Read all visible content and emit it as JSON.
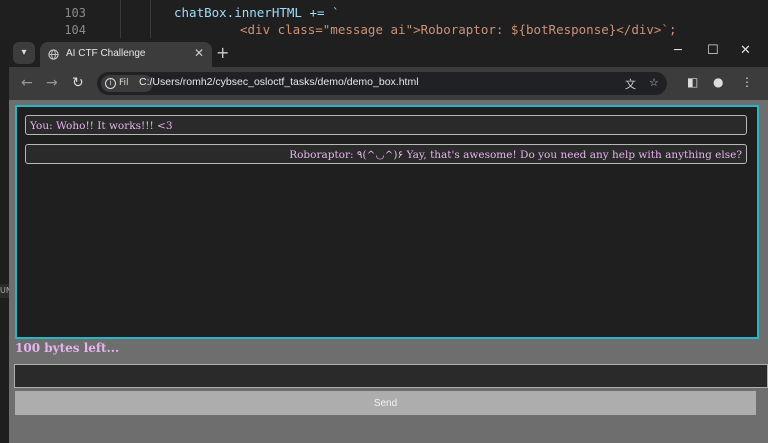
{
  "editor": {
    "lines": [
      {
        "number": "103",
        "code": "chatBox.innerHTML += `"
      },
      {
        "number": "104",
        "code": "<div class=\"message ai\">Roboraptor: ${botResponse}</div>`;"
      }
    ]
  },
  "side_label": "UN",
  "browser": {
    "tab_title": "AI CTF Challenge",
    "new_tab": "+",
    "address_chip": "Fil",
    "url": "C:/Users/romh2/cybsec_osloctf_tasks/demo/demo_box.html",
    "icons": {
      "tab_menu": "chevron-down-icon",
      "favicon": "globe-icon",
      "tab_close": "close-icon",
      "minimize": "minimize-icon",
      "maximize": "maximize-icon",
      "close": "close-icon",
      "back": "arrow-left-icon",
      "forward": "arrow-right-icon",
      "reload": "reload-icon",
      "info": "info-icon",
      "translate": "translate-icon",
      "bookmark": "star-icon",
      "side_panel": "side-panel-icon",
      "profile": "profile-icon",
      "menu": "kebab-menu-icon"
    }
  },
  "chat": {
    "messages": [
      {
        "role": "user",
        "text": "You: Woho!! It works!!! <3"
      },
      {
        "role": "ai",
        "text": "Roboraptor: ٩(^◡^)۶ Yay, that's awesome! Do you need any help with anything else?"
      }
    ],
    "bytes_left": "100 bytes left...",
    "input_value": "",
    "send_label": "Send"
  },
  "colors": {
    "accent_border": "#27b6c5",
    "message_text": "#e7b4ef",
    "page_bg": "#6e6e6e",
    "send_button": "#adadad"
  }
}
